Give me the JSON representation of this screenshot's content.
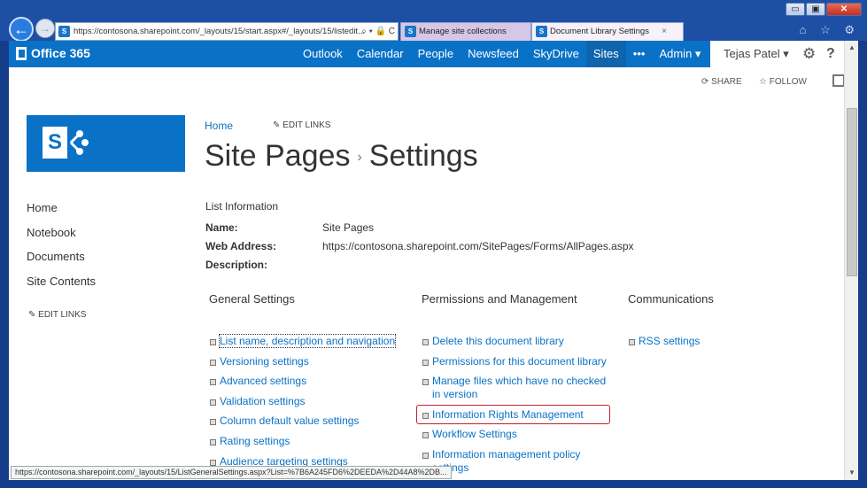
{
  "window": {
    "controls": [
      "▭",
      "▣",
      "✕"
    ]
  },
  "browser": {
    "address_url": "https://contosona.sharepoint.com/_layouts/15/start.aspx#/_layouts/15/listedit...",
    "address_tools": "⌕ ▾ 🔒 C",
    "tabs": [
      {
        "title": "Manage site collections"
      },
      {
        "title": "Document Library Settings",
        "close": "×"
      }
    ],
    "toolbar_icons": "⌂ ☆ ⚙"
  },
  "suitebar": {
    "brand": "Office 365",
    "nav": [
      "Outlook",
      "Calendar",
      "People",
      "Newsfeed",
      "SkyDrive",
      "Sites",
      "•••",
      "Admin ▾"
    ],
    "active": "Sites",
    "user": "Tejas Patel ▾",
    "gear_icon": "⚙",
    "help_icon": "?"
  },
  "actions": {
    "share": "SHARE",
    "follow": "FOLLOW"
  },
  "site": {
    "logo_letter": "S",
    "breadcrumb_home": "Home",
    "edit_links": "EDIT LINKS",
    "title_part1": "Site Pages",
    "title_sep": "›",
    "title_part2": "Settings"
  },
  "leftnav": {
    "items": [
      "Home",
      "Notebook",
      "Documents",
      "Site Contents"
    ],
    "edit_links": "EDIT LINKS"
  },
  "list_info": {
    "heading": "List Information",
    "name_label": "Name:",
    "name_value": "Site Pages",
    "address_label": "Web Address:",
    "address_value": "https://contosona.sharepoint.com/SitePages/Forms/AllPages.aspx",
    "description_label": "Description:"
  },
  "columns": {
    "general": {
      "heading": "General Settings",
      "items": [
        "List name, description and navigation",
        "Versioning settings",
        "Advanced settings",
        "Validation settings",
        "Column default value settings",
        "Rating settings",
        "Audience targeting settings"
      ]
    },
    "permissions": {
      "heading": "Permissions and Management",
      "items": [
        "Delete this document library",
        "Permissions for this document library",
        "Manage files which have no checked in version",
        "Information Rights Management",
        "Workflow Settings",
        "Information management policy settings"
      ]
    },
    "communications": {
      "heading": "Communications",
      "items": [
        "RSS settings"
      ]
    }
  },
  "statusbar": {
    "text": "https://contosona.sharepoint.com/_layouts/15/ListGeneralSettings.aspx?List=%7B6A245FD6%2DEEDA%2D44A8%2DB..."
  },
  "colors": {
    "accent": "#0a72c6",
    "highlight": "#c3202b",
    "chrome": "#1d4fa5"
  }
}
